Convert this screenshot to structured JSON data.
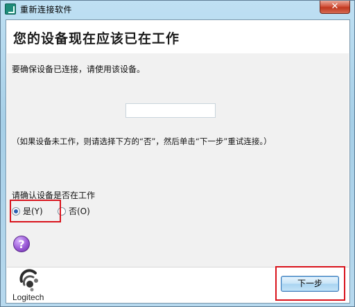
{
  "window": {
    "title": "重新连接软件",
    "close_glyph": "✕"
  },
  "content": {
    "heading": "您的设备现在应该已在工作",
    "instruction": "要确保设备已连接，请使用该设备。",
    "hint": "（如果设备未工作，则请选择下方的“否”，然后单击“下一步”重试连接。）",
    "confirm_label": "请确认设备是否在工作",
    "options": [
      {
        "label": "是(Y)",
        "checked": true
      },
      {
        "label": "否(O)",
        "checked": false
      }
    ],
    "help_glyph": "?"
  },
  "footer": {
    "brand": "Logitech",
    "next_label": "下一步"
  },
  "colors": {
    "highlight": "#d9121b",
    "brand_green": "#1e8c7a"
  },
  "icons": [
    "app-icon",
    "close-icon",
    "help-icon",
    "logitech-logo-icon"
  ]
}
